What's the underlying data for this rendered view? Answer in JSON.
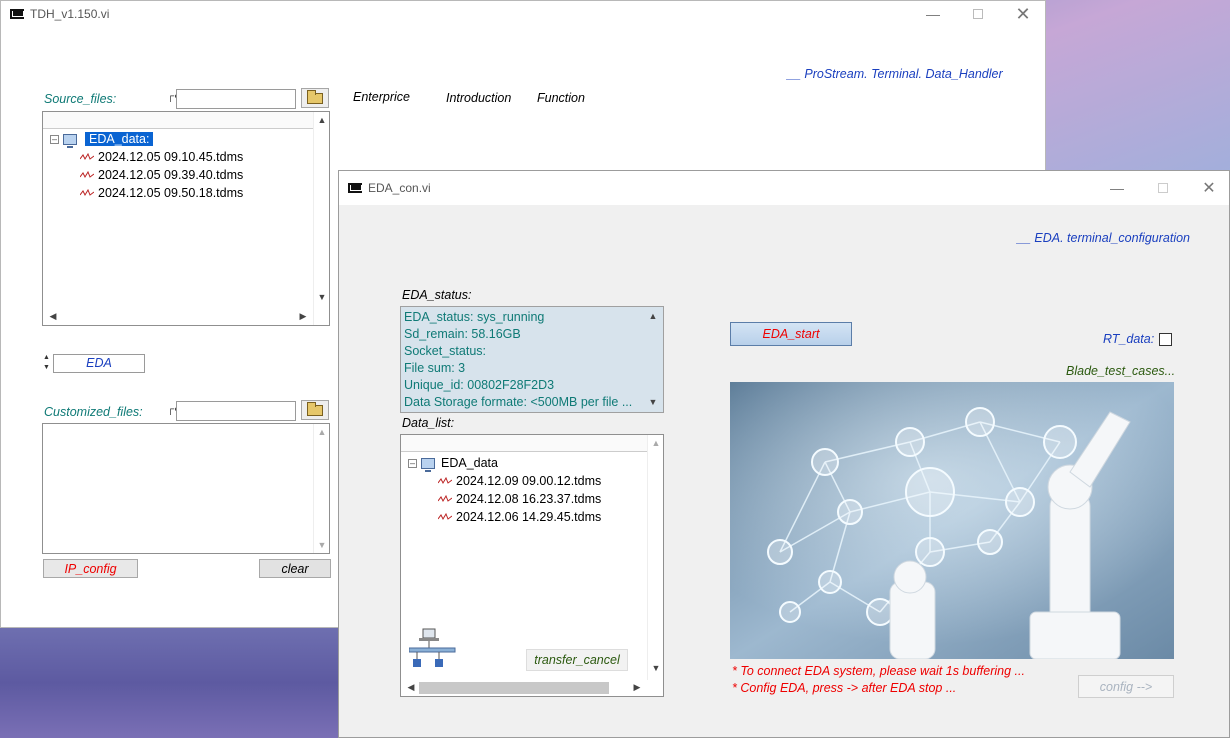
{
  "main_window": {
    "title": "TDH_v1.150.vi",
    "header_link": "__ ProStream. Terminal. Data_Handler",
    "menu": [
      "Enterprice",
      "Introduction",
      "Function"
    ],
    "source_files_label": "Source_files:",
    "source_path_value": "",
    "source_tree": {
      "root": "EDA_data:",
      "files": [
        "2024.12.05 09.10.45.tdms",
        "2024.12.05 09.39.40.tdms",
        "2024.12.05 09.50.18.tdms"
      ]
    },
    "selector_value": "EDA",
    "customized_files_label": "Customized_files:",
    "customized_path_value": "",
    "ip_config_label": "IP_config",
    "clear_label": "clear"
  },
  "eda_window": {
    "title": "EDA_con.vi",
    "header_link": "__ EDA. terminal_configuration",
    "status_label": "EDA_status:",
    "status_lines": [
      "EDA_status:   sys_running",
      "Sd_remain:   58.16GB",
      "Socket_status:",
      "File sum:  3",
      "Unique_id:  00802F28F2D3",
      "Data Storage formate: <500MB per file ..."
    ],
    "data_list_label": "Data_list:",
    "data_tree": {
      "root": "EDA_data",
      "files": [
        "2024.12.09 09.00.12.tdms",
        "2024.12.08 16.23.37.tdms",
        "2024.12.06 14.29.45.tdms"
      ]
    },
    "transfer_cancel_label": "transfer_cancel",
    "eda_start_label": "EDA_start",
    "rt_data_label": "RT_data:",
    "rt_data_checked": false,
    "blade_label": "Blade_test_cases...",
    "notes": [
      "* To connect  EDA system, please wait 1s buffering ...",
      "* Config EDA, press -> after  EDA stop ..."
    ],
    "config_label": "config -->"
  },
  "colors": {
    "teal_label": "#0f7a76",
    "link_blue": "#1a3fbf",
    "warning_red": "#e00000",
    "status_bg": "#d7e3ec",
    "selection_blue": "#0a64d2"
  }
}
